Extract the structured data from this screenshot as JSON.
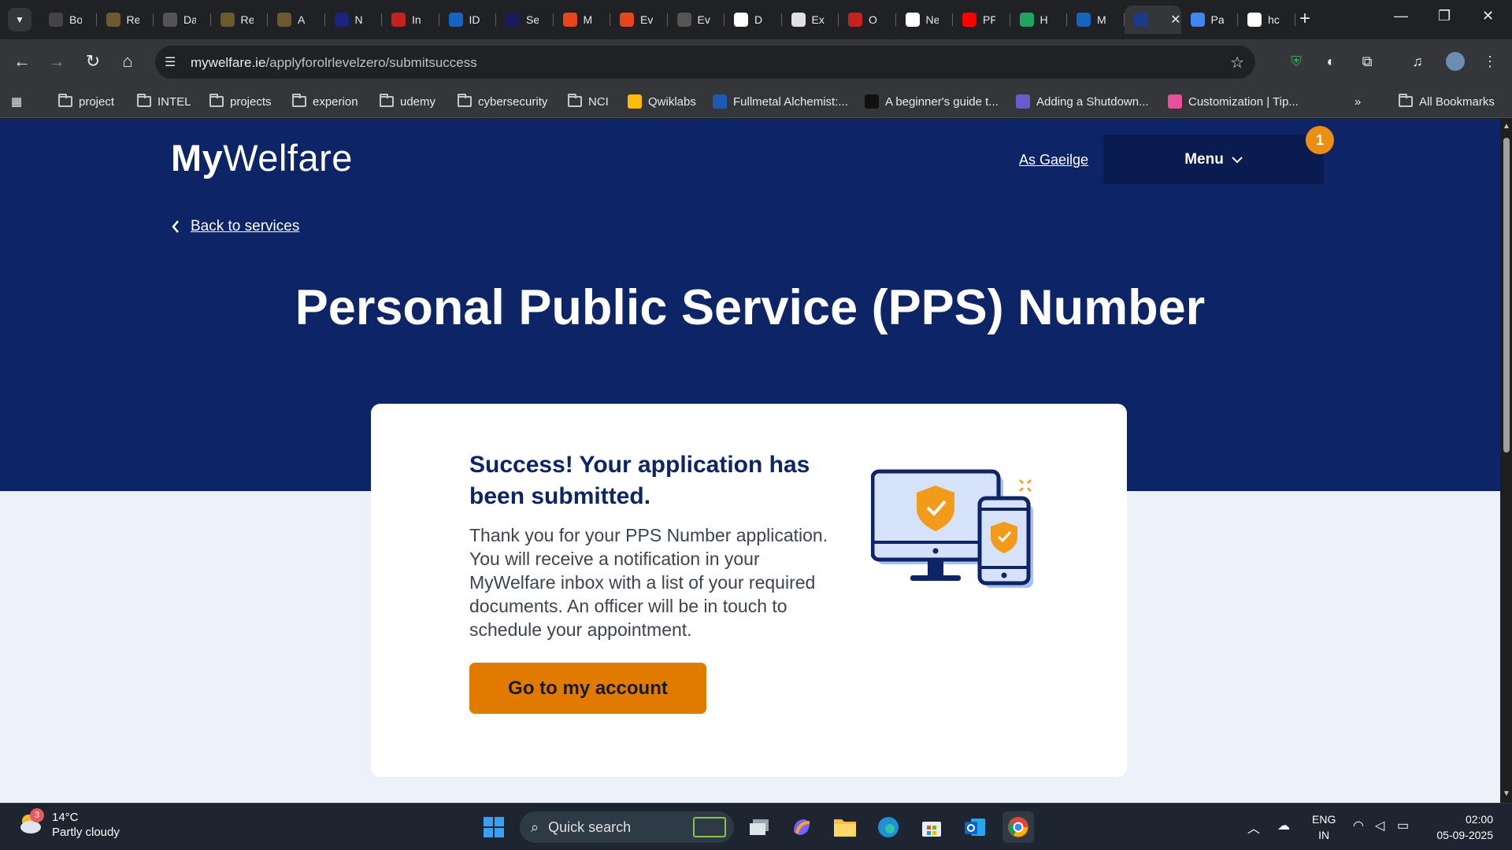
{
  "browser": {
    "tabs": [
      {
        "label": "Bo",
        "icon": "chatgpt-icon",
        "color": "#444"
      },
      {
        "label": "Re",
        "icon": "harp-icon",
        "color": "#6b5a2e"
      },
      {
        "label": "Da",
        "icon": "globe-icon",
        "color": "#555"
      },
      {
        "label": "Re",
        "icon": "harp-icon",
        "color": "#6b5a2e"
      },
      {
        "label": "A",
        "icon": "harp-icon",
        "color": "#6b5a2e"
      },
      {
        "label": "N",
        "icon": "infinity-icon",
        "color": "#1a237e"
      },
      {
        "label": "In",
        "icon": "gmail-icon",
        "color": "#c5221f"
      },
      {
        "label": "ID",
        "icon": "id-icon",
        "color": "#1565c0"
      },
      {
        "label": "Se",
        "icon": "n-icon",
        "color": "#1a1a5e"
      },
      {
        "label": "M",
        "icon": "bolt-icon",
        "color": "#e8451b"
      },
      {
        "label": "Ev",
        "icon": "bolt-icon",
        "color": "#e8451b"
      },
      {
        "label": "Ev",
        "icon": "globe-icon",
        "color": "#555"
      },
      {
        "label": "D",
        "icon": "google-icon",
        "color": "#ffffff"
      },
      {
        "label": "Ex",
        "icon": "palette-icon",
        "color": "#e0e0e0"
      },
      {
        "label": "O",
        "icon": "gmail-icon",
        "color": "#c5221f"
      },
      {
        "label": "Ne",
        "icon": "chatgpt-icon",
        "color": "#ffffff"
      },
      {
        "label": "PF",
        "icon": "youtube-icon",
        "color": "#ff0000"
      },
      {
        "label": "H",
        "icon": "drive-icon",
        "color": "#1fa463"
      },
      {
        "label": "M",
        "icon": "id-icon",
        "color": "#1565c0"
      },
      {
        "label": "",
        "icon": "mywelfare-icon",
        "color": "#1d3a8a",
        "active": true
      },
      {
        "label": "Pa",
        "icon": "docs-icon",
        "color": "#4285f4"
      },
      {
        "label": "hc",
        "icon": "google-icon",
        "color": "#ffffff"
      }
    ],
    "url_host": "mywelfare.ie",
    "url_path": "/applyforolrlevelzero/submitsuccess",
    "bookmarks": [
      {
        "label": "project",
        "type": "folder"
      },
      {
        "label": "INTEL",
        "type": "folder"
      },
      {
        "label": "projects",
        "type": "folder"
      },
      {
        "label": "experion",
        "type": "folder"
      },
      {
        "label": "udemy",
        "type": "folder"
      },
      {
        "label": "cybersecurity",
        "type": "folder"
      },
      {
        "label": "NCI",
        "type": "folder"
      },
      {
        "label": "Qwiklabs",
        "type": "site",
        "color": "#fbbc04"
      },
      {
        "label": "Fullmetal Alchemist:...",
        "type": "site",
        "color": "#1e5ab4"
      },
      {
        "label": "A beginner's guide t...",
        "type": "site",
        "color": "#111111"
      },
      {
        "label": "Adding a Shutdown...",
        "type": "site",
        "color": "#6a5acd"
      },
      {
        "label": "Customization | Tip...",
        "type": "site",
        "color": "#e94f9a"
      }
    ],
    "bookmarks_more": "»",
    "all_bookmarks": "All Bookmarks"
  },
  "header": {
    "logo_bold": "My",
    "logo_light": "Welfare",
    "language_link": "As Gaeilge",
    "menu_label": "Menu",
    "menu_badge": "1"
  },
  "nav": {
    "back_label": "Back to services"
  },
  "page": {
    "title": "Personal Public Service (PPS) Number"
  },
  "card": {
    "heading": "Success! Your application has been submitted.",
    "body": "Thank you for your PPS Number application. You will receive a notification in your MyWelfare inbox with a list of your required documents. An officer will be in touch to schedule your appointment.",
    "cta_label": "Go to my account"
  },
  "taskbar": {
    "weather_temp": "14°C",
    "weather_desc": "Partly cloudy",
    "weather_badge": "3",
    "search_placeholder": "Quick search",
    "lang_top": "ENG",
    "lang_bottom": "IN",
    "time": "02:00",
    "date": "05-09-2025"
  },
  "colors": {
    "hero_blue": "#0d2467",
    "cta_orange": "#e07b00",
    "badge_orange": "#ec8e11",
    "page_bg": "#edf1fa"
  }
}
